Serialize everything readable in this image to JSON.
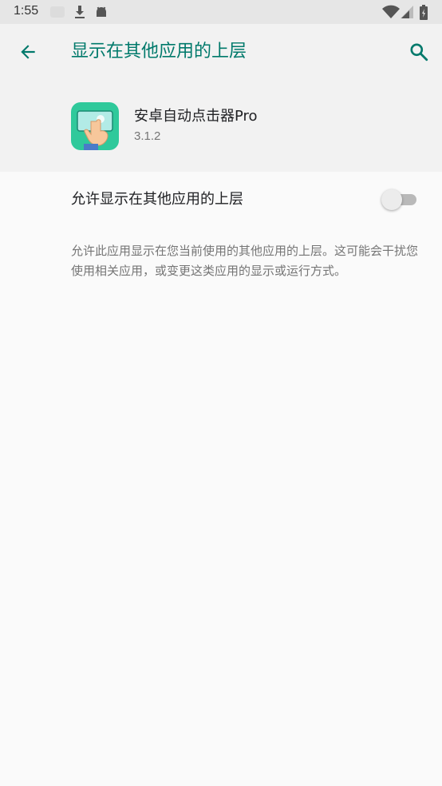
{
  "status_bar": {
    "time": "1:55",
    "icons": [
      "download-icon",
      "android-icon",
      "wifi-icon",
      "signal-icon",
      "battery-icon"
    ]
  },
  "toolbar": {
    "title": "显示在其他应用的上层",
    "back_icon": "arrow-back-icon",
    "search_icon": "search-icon"
  },
  "app": {
    "name": "安卓自动点击器Pro",
    "version": "3.1.2"
  },
  "setting": {
    "label": "允许显示在其他应用的上层",
    "enabled": false
  },
  "description": "允许此应用显示在您当前使用的其他应用的上层。这可能会干扰您使用相关应用，或变更这类应用的显示或运行方式。",
  "colors": {
    "accent": "#00796b",
    "status_bar_bg": "#e6e6e6",
    "header_bg": "#f2f2f2",
    "page_bg": "#fafafa",
    "app_icon_bg": "#2fc99b"
  }
}
